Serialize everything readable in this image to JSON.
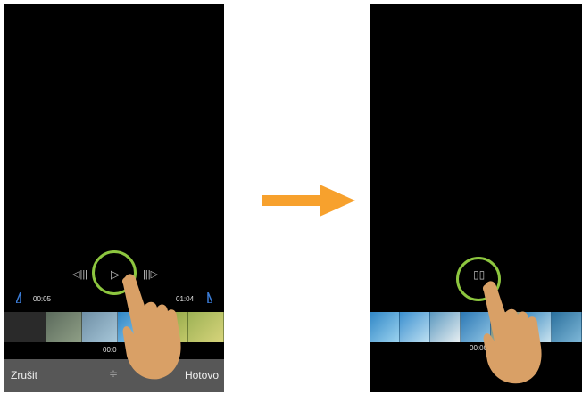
{
  "left": {
    "controls": {
      "rewind_icon": "◁|||",
      "play_icon": "▷",
      "forward_icon": "|||▷"
    },
    "trim": {
      "start_time": "00:05",
      "end_time": "01:04"
    },
    "playhead_time": "00:0",
    "bottom_bar": {
      "cancel_label": "Zrušit",
      "done_label": "Hotovo",
      "adjust_icon": "≑"
    }
  },
  "right": {
    "controls": {
      "pause_icon": "▯▯"
    },
    "playhead_time": "00:00"
  },
  "colors": {
    "accent_ring": "#8dc63f",
    "arrow": "#f7a12d",
    "trim_handle": "#3a7bd5",
    "skin": "#d9a066"
  }
}
